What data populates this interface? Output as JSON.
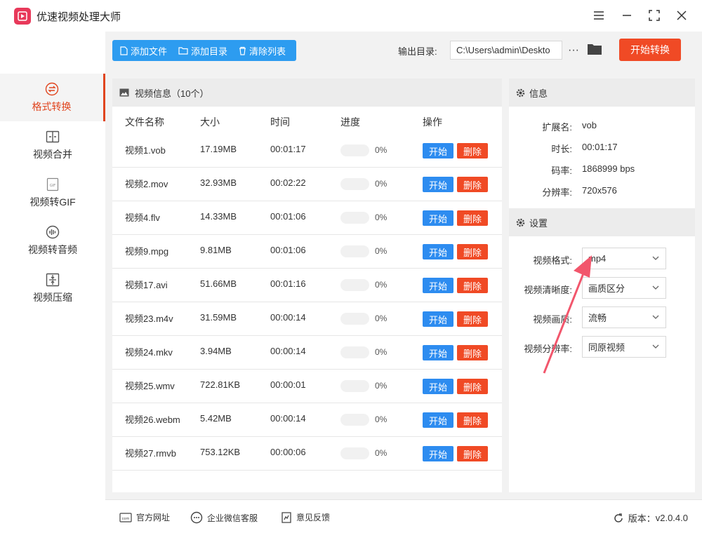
{
  "app": {
    "title": "优速视频处理大师"
  },
  "sidebar": {
    "items": [
      {
        "label": "格式转换",
        "icon": "format-convert-icon",
        "active": true
      },
      {
        "label": "视频合并",
        "icon": "merge-icon",
        "active": false
      },
      {
        "label": "视频转GIF",
        "icon": "gif-icon",
        "active": false
      },
      {
        "label": "视频转音频",
        "icon": "audio-icon",
        "active": false
      },
      {
        "label": "视频压缩",
        "icon": "compress-icon",
        "active": false
      }
    ]
  },
  "toolbar": {
    "add_file": "添加文件",
    "add_dir": "添加目录",
    "clear_list": "清除列表",
    "output_label": "输出目录:",
    "output_path": "C:\\Users\\admin\\Deskto",
    "more": "···",
    "start_all": "开始转换"
  },
  "list": {
    "title": "视频信息（10个）",
    "columns": {
      "name": "文件名称",
      "size": "大小",
      "time": "时间",
      "progress": "进度",
      "action": "操作"
    },
    "start_label": "开始",
    "delete_label": "删除",
    "rows": [
      {
        "name": "视频1.vob",
        "size": "17.19MB",
        "time": "00:01:17",
        "progress": 0,
        "pct": "0%"
      },
      {
        "name": "视频2.mov",
        "size": "32.93MB",
        "time": "00:02:22",
        "progress": 0,
        "pct": "0%"
      },
      {
        "name": "视频4.flv",
        "size": "14.33MB",
        "time": "00:01:06",
        "progress": 0,
        "pct": "0%"
      },
      {
        "name": "视频9.mpg",
        "size": "9.81MB",
        "time": "00:01:06",
        "progress": 0,
        "pct": "0%"
      },
      {
        "name": "视频17.avi",
        "size": "51.66MB",
        "time": "00:01:16",
        "progress": 0,
        "pct": "0%"
      },
      {
        "name": "视频23.m4v",
        "size": "31.59MB",
        "time": "00:00:14",
        "progress": 0,
        "pct": "0%"
      },
      {
        "name": "视频24.mkv",
        "size": "3.94MB",
        "time": "00:00:14",
        "progress": 0,
        "pct": "0%"
      },
      {
        "name": "视频25.wmv",
        "size": "722.81KB",
        "time": "00:00:01",
        "progress": 0,
        "pct": "0%"
      },
      {
        "name": "视频26.webm",
        "size": "5.42MB",
        "time": "00:00:14",
        "progress": 0,
        "pct": "0%"
      },
      {
        "name": "视频27.rmvb",
        "size": "753.12KB",
        "time": "00:00:06",
        "progress": 0,
        "pct": "0%"
      }
    ]
  },
  "info": {
    "title": "信息",
    "ext_label": "扩展名:",
    "ext": "vob",
    "duration_label": "时长:",
    "duration": "00:01:17",
    "bitrate_label": "码率:",
    "bitrate": "1868999 bps",
    "resolution_label": "分辨率:",
    "resolution": "720x576"
  },
  "settings": {
    "title": "设置",
    "format_label": "视频格式:",
    "format": "mp4",
    "clarity_label": "视频清晰度:",
    "clarity": "画质区分",
    "quality_label": "视频画质:",
    "quality": "流畅",
    "resolution_label": "视频分辨率:",
    "resolution": "同原视频"
  },
  "footer": {
    "website": "官方网址",
    "wechat": "企业微信客服",
    "feedback": "意见反馈",
    "version_label": "版本：",
    "version": "v2.0.4.0"
  },
  "colors": {
    "accent": "#f04a25",
    "primary": "#2d9cf0"
  }
}
